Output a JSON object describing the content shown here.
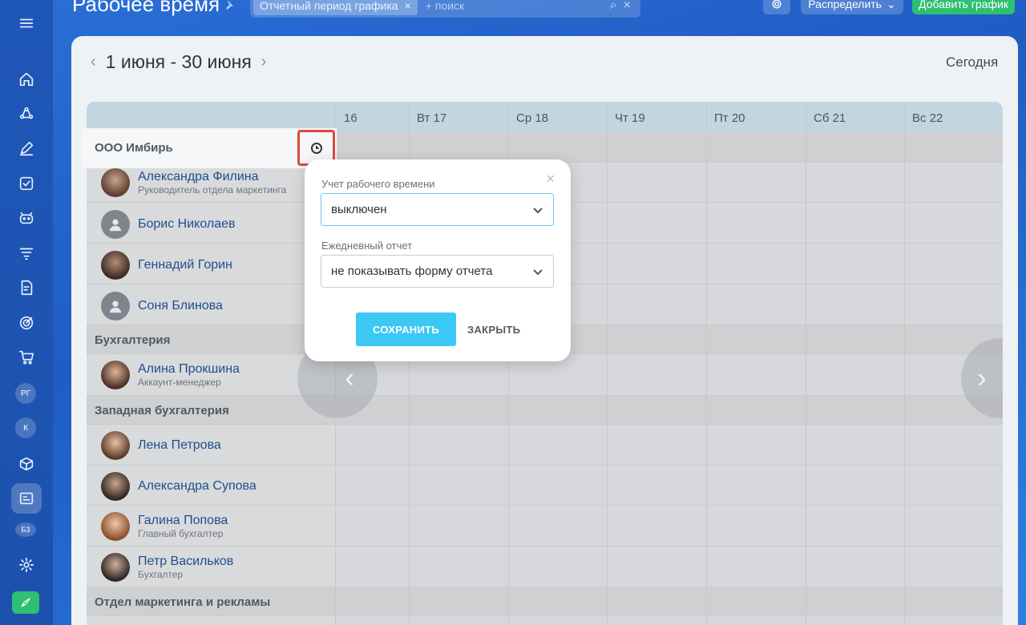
{
  "header": {
    "title": "Рабочее время",
    "filter_chip": "Отчетный период графика",
    "search_placeholder": "+ поиск",
    "distribute_label": "Распределить",
    "add_schedule_label": "Добавить график"
  },
  "sidebar": {
    "avatars": [
      "РГ",
      "К",
      "БЗ"
    ]
  },
  "calendar": {
    "period": "1 июня - 30 июня",
    "today_label": "Сегодня",
    "days": [
      "16",
      "Вт 17",
      "Ср 18",
      "Чт 19",
      "Пт 20",
      "Сб 21",
      "Вс 22"
    ]
  },
  "departments": [
    {
      "name": "ООО Имбирь"
    },
    {
      "name": "Бухгалтерия"
    },
    {
      "name": "Западная бухгалтерия"
    },
    {
      "name": "Отдел маркетинга и рекламы"
    }
  ],
  "employees": [
    {
      "name": "Александра Филина",
      "role": "Руководитель отдела маркетинга"
    },
    {
      "name": "Борис Николаев",
      "role": ""
    },
    {
      "name": "Геннадий Горин",
      "role": ""
    },
    {
      "name": "Соня Блинова",
      "role": ""
    },
    {
      "name": "Алина Прокшина",
      "role": "Аккаунт-менеджер"
    },
    {
      "name": "Лена Петрова",
      "role": ""
    },
    {
      "name": "Александра Супова",
      "role": ""
    },
    {
      "name": "Галина Попова",
      "role": "Главный бухгалтер"
    },
    {
      "name": "Петр Васильков",
      "role": "Бухгалтер"
    }
  ],
  "popup": {
    "time_tracking_label": "Учет рабочего времени",
    "time_tracking_value": "выключен",
    "daily_report_label": "Ежедневный отчет",
    "daily_report_value": "не показывать форму отчета",
    "save_label": "СОХРАНИТЬ",
    "close_label": "ЗАКРЫТЬ"
  },
  "colors": {
    "accent": "#3bc8f5",
    "add_button": "#2fbf71",
    "highlight_border": "#e0493e"
  }
}
